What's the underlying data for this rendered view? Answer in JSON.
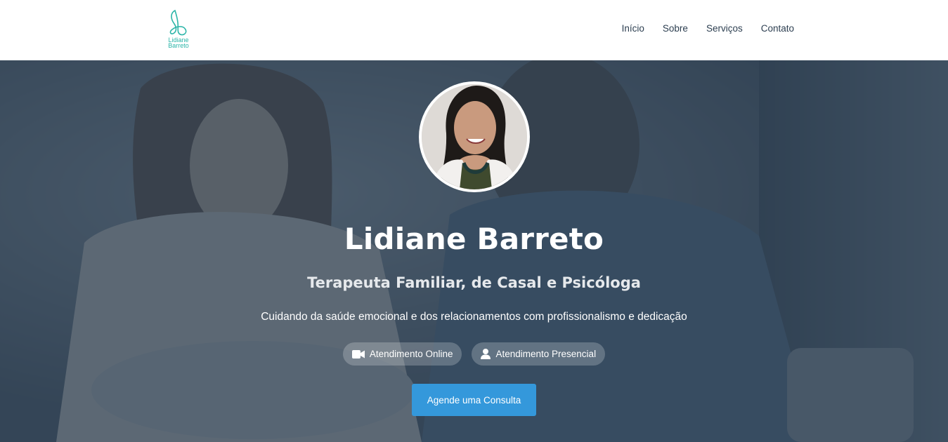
{
  "brand": {
    "logo_icon": "lb-monogram-icon",
    "logo_line1": "Lidiane",
    "logo_line2": "Barreto",
    "accent_color": "#2bb5a8"
  },
  "nav": {
    "items": [
      {
        "label": "Início"
      },
      {
        "label": "Sobre"
      },
      {
        "label": "Serviços"
      },
      {
        "label": "Contato"
      }
    ]
  },
  "hero": {
    "name": "Lidiane Barreto",
    "subtitle": "Terapeuta Familiar, de Casal e Psicóloga",
    "tagline": "Cuidando da saúde emocional e dos relacionamentos com profissionalismo e dedicação",
    "badges": [
      {
        "icon": "video-camera-icon",
        "label": "Atendimento Online"
      },
      {
        "icon": "user-icon",
        "label": "Atendimento Presencial"
      }
    ],
    "cta_label": "Agende uma Consulta",
    "cta_color": "#3498db",
    "overlay_color": "#2c3e50"
  }
}
